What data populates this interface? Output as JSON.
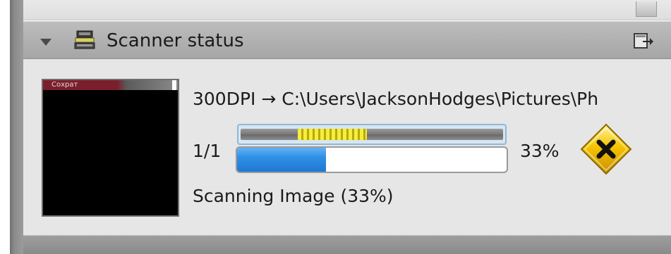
{
  "panel": {
    "title": "Scanner status",
    "icons": {
      "collapse": "collapse-triangle-icon",
      "scanner": "scanner-icon",
      "detach": "detach-panel-icon",
      "cancel": "cancel-scan-icon"
    }
  },
  "preview": {
    "thumbnail_label": "Сохрат"
  },
  "scan": {
    "destination": "300DPI → C:\\Users\\JacksonHodges\\Pictures\\Ph",
    "page_counter": "1/1",
    "percent_label": "33%",
    "progress_value": 0.33,
    "status_text": "Scanning Image (33%)"
  },
  "colors": {
    "progress_fill": "#2f8fe6",
    "marquee_glow": "#f6ee3a",
    "cancel_fill": "#f5c400",
    "header_bg": "#b0b0b0",
    "panel_bg": "#e6e6e6"
  }
}
